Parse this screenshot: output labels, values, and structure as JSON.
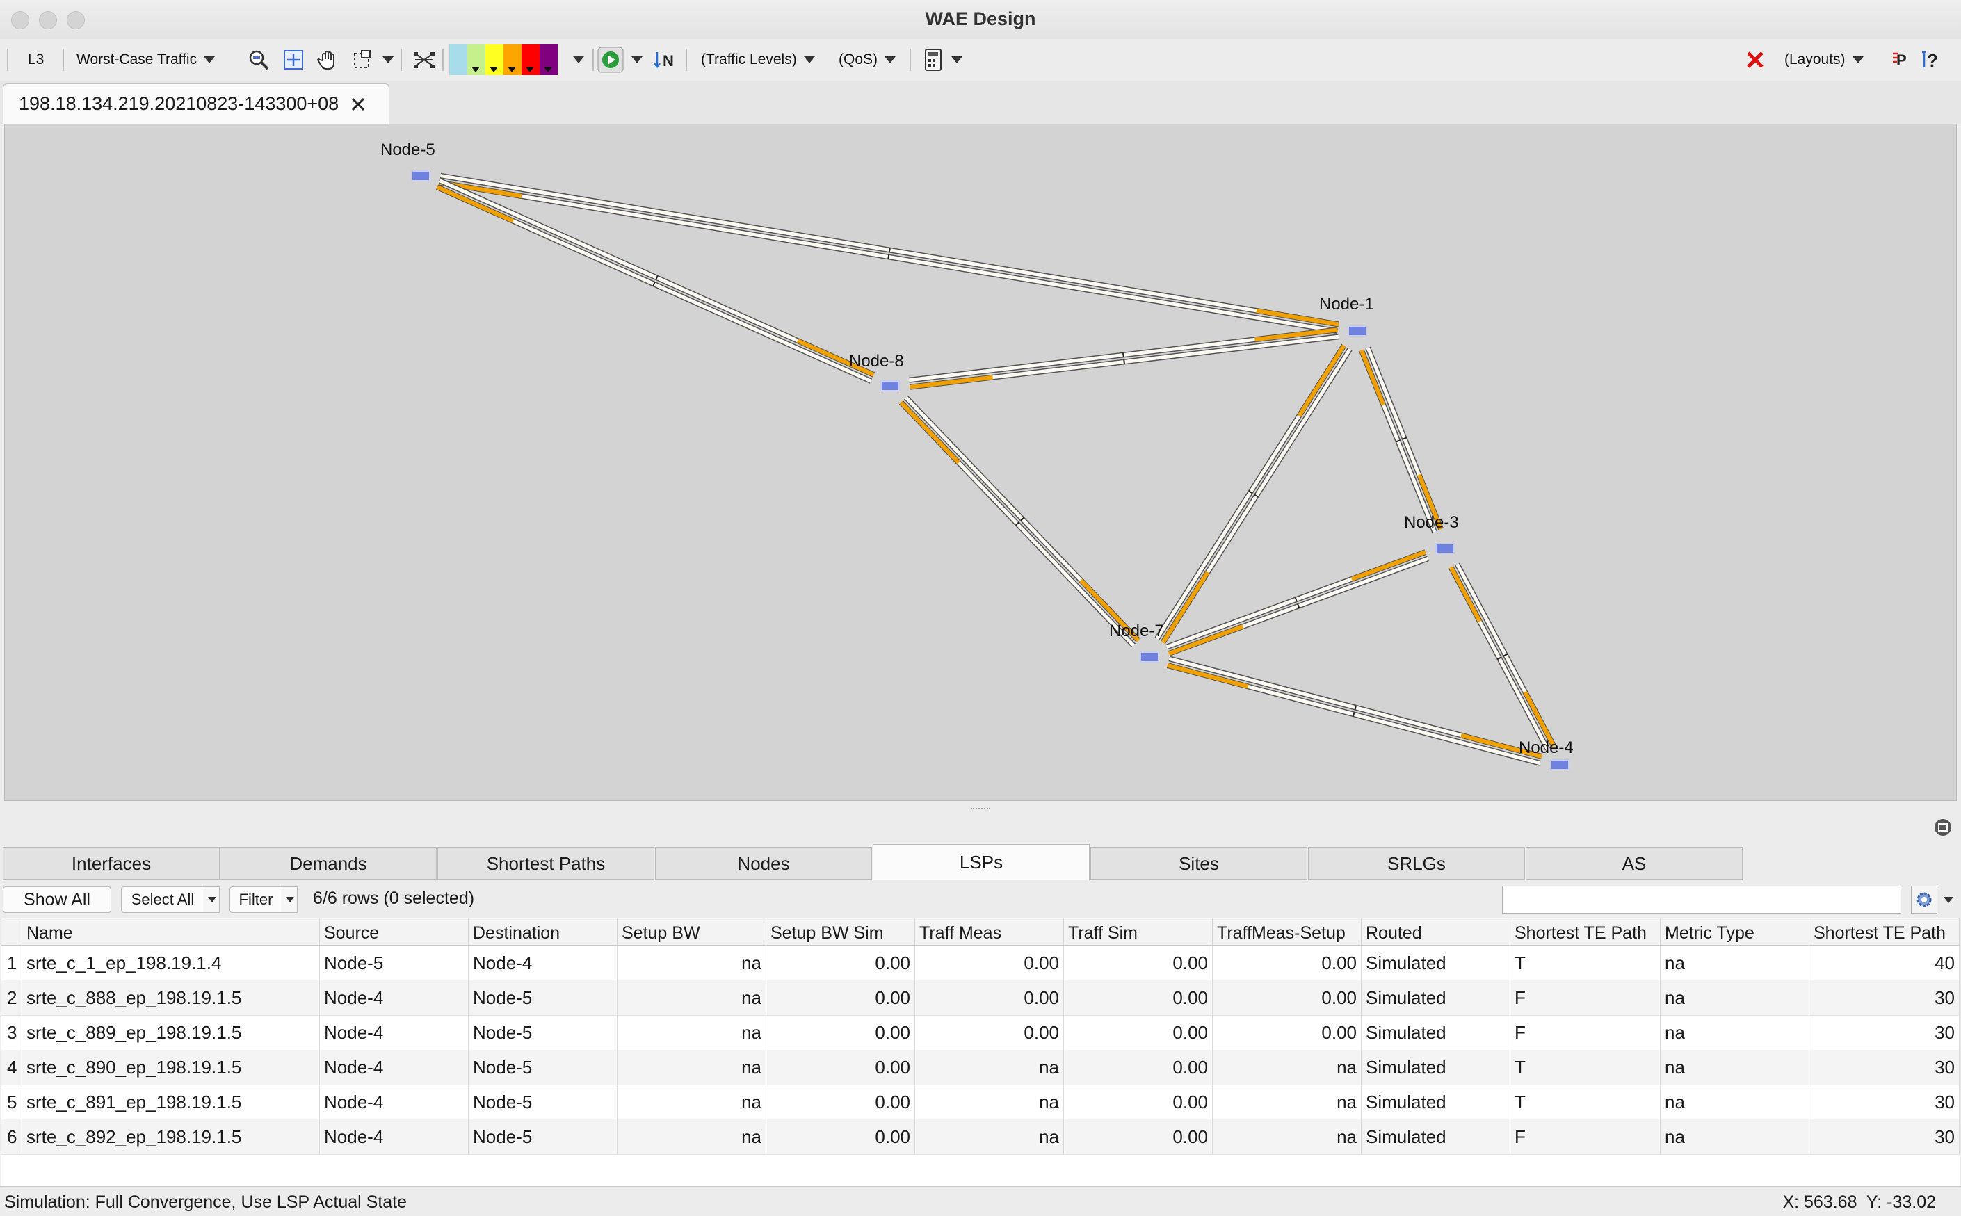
{
  "window": {
    "title": "WAE Design"
  },
  "toolbar": {
    "layer": "L3",
    "traffic_mode": "Worst-Case Traffic",
    "traffic_levels": "(Traffic Levels)",
    "qos": "(QoS)",
    "layouts": "(Layouts)",
    "colors": [
      "#a9dcea",
      "#c6f08c",
      "#ffff22",
      "#ffa500",
      "#ff0000",
      "#800080"
    ]
  },
  "doc_tab": {
    "label": "198.18.134.219.20210823-143300+08"
  },
  "map": {
    "nodes": [
      {
        "label": "Node-5"
      },
      {
        "label": "Node-1"
      },
      {
        "label": "Node-8"
      },
      {
        "label": "Node-3"
      },
      {
        "label": "Node-7"
      },
      {
        "label": "Node-4"
      }
    ],
    "link_color": "#f0a000"
  },
  "tabs": [
    "Interfaces",
    "Demands",
    "Shortest Paths",
    "Nodes",
    "LSPs",
    "Sites",
    "SRLGs",
    "AS"
  ],
  "active_tab": "LSPs",
  "actions": {
    "show_all": "Show All",
    "select_all": "Select All",
    "filter": "Filter",
    "row_count": "6/6 rows (0 selected)"
  },
  "table": {
    "columns": [
      "Name",
      "Source",
      "Destination",
      "Setup BW",
      "Setup BW Sim",
      "Traff Meas",
      "Traff Sim",
      "TraffMeas-Setup",
      "Routed",
      "Shortest TE Path",
      "Metric Type",
      "Shortest TE Path"
    ],
    "rows": [
      {
        "n": "1",
        "cells": [
          "srte_c_1_ep_198.19.1.4",
          "Node-5",
          "Node-4",
          "na",
          "0.00",
          "0.00",
          "0.00",
          "0.00",
          "Simulated",
          "T",
          "na",
          "40"
        ]
      },
      {
        "n": "2",
        "cells": [
          "srte_c_888_ep_198.19.1.5",
          "Node-4",
          "Node-5",
          "na",
          "0.00",
          "0.00",
          "0.00",
          "0.00",
          "Simulated",
          "F",
          "na",
          "30"
        ]
      },
      {
        "n": "3",
        "cells": [
          "srte_c_889_ep_198.19.1.5",
          "Node-4",
          "Node-5",
          "na",
          "0.00",
          "0.00",
          "0.00",
          "0.00",
          "Simulated",
          "F",
          "na",
          "30"
        ]
      },
      {
        "n": "4",
        "cells": [
          "srte_c_890_ep_198.19.1.5",
          "Node-4",
          "Node-5",
          "na",
          "0.00",
          "na",
          "0.00",
          "na",
          "Simulated",
          "T",
          "na",
          "30"
        ]
      },
      {
        "n": "5",
        "cells": [
          "srte_c_891_ep_198.19.1.5",
          "Node-4",
          "Node-5",
          "na",
          "0.00",
          "na",
          "0.00",
          "na",
          "Simulated",
          "T",
          "na",
          "30"
        ]
      },
      {
        "n": "6",
        "cells": [
          "srte_c_892_ep_198.19.1.5",
          "Node-4",
          "Node-5",
          "na",
          "0.00",
          "na",
          "0.00",
          "na",
          "Simulated",
          "F",
          "na",
          "30"
        ]
      }
    ]
  },
  "status": {
    "left": "Simulation: Full Convergence, Use LSP Actual State",
    "right": "X: 563.68  Y: -33.02"
  }
}
